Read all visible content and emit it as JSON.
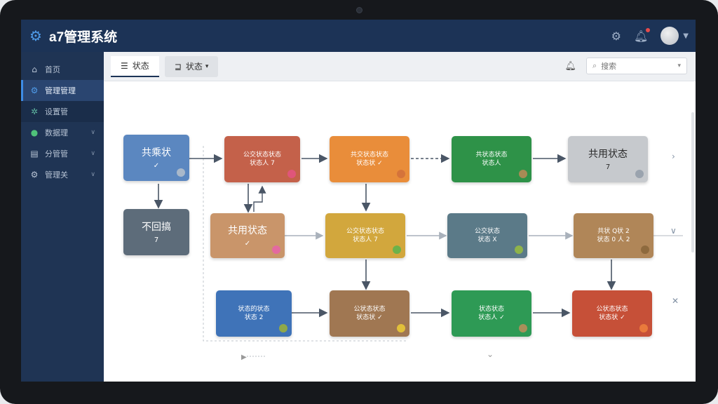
{
  "app": {
    "title": "a7管理系统"
  },
  "sidebar": {
    "items": [
      {
        "label": "首页",
        "icon": "home-icon"
      },
      {
        "label": "管理管理",
        "icon": "gear-icon"
      },
      {
        "label": "设置管",
        "icon": "users-icon"
      },
      {
        "label": "数据理",
        "icon": "shield-icon"
      },
      {
        "label": "分管管",
        "icon": "calendar-icon"
      },
      {
        "label": "管理关",
        "icon": "gear-icon"
      }
    ]
  },
  "toolbar": {
    "tab_active": "状态",
    "tab_second": "状态",
    "search_placeholder": "搜索"
  },
  "nodes": [
    {
      "id": "n1",
      "line1": "共乘状",
      "line2": "✓",
      "color": "#5b87c0",
      "dot": "#a9b8ca"
    },
    {
      "id": "n2",
      "line1": "不回搞",
      "line2": "7",
      "color": "#5d6c7a",
      "dot": ""
    },
    {
      "id": "n3",
      "line1": "公交状态状态",
      "line2": "状态人 7",
      "color": "#c4614a",
      "dot": "#e0557a"
    },
    {
      "id": "n4",
      "line1": "共用状态",
      "line2": "✓",
      "color": "#c9956a",
      "dot": "#e36aa0"
    },
    {
      "id": "n5",
      "line1": "状态的状态",
      "line2": "状态 2",
      "color": "#3f73b8",
      "dot": "#8fa84a"
    },
    {
      "id": "n6",
      "line1": "共交状态状态",
      "line2": "状态状 ✓",
      "color": "#e98d3a",
      "dot": "#d5733a"
    },
    {
      "id": "n7",
      "line1": "公交状态状态",
      "line2": "状态人 7",
      "color": "#d2a73d",
      "dot": "#6cb24a"
    },
    {
      "id": "n8",
      "line1": "公状态状态",
      "line2": "状态状 ✓",
      "color": "#a07752",
      "dot": "#e1c03a"
    },
    {
      "id": "n9",
      "line1": "共状态状态",
      "line2": "状态人",
      "color": "#2e9248",
      "dot": "#a78b55"
    },
    {
      "id": "n10",
      "line1": "公交状态",
      "line2": "状态 X",
      "color": "#5b7a88",
      "dot": "#8fb34a"
    },
    {
      "id": "n11",
      "line1": "状态状态",
      "line2": "状态人 ✓",
      "color": "#2e9a55",
      "dot": "#a88f5a"
    },
    {
      "id": "n12",
      "line1": "共用状态",
      "line2": "7",
      "color": "#c6c9cd",
      "dot": "#9aa3ae"
    },
    {
      "id": "n13",
      "line1": "共状 Q状 2",
      "line2": "状态 0 人 2",
      "color": "#b08658",
      "dot": "#8e6a3e"
    },
    {
      "id": "n14",
      "line1": "公状态状态",
      "line2": "状态状 ✓",
      "color": "#c65038",
      "dot": "#e97a3c"
    }
  ],
  "colors": {
    "topbar": "#1c3356",
    "sidebar": "#1f3454",
    "accent": "#3d8ce6"
  }
}
